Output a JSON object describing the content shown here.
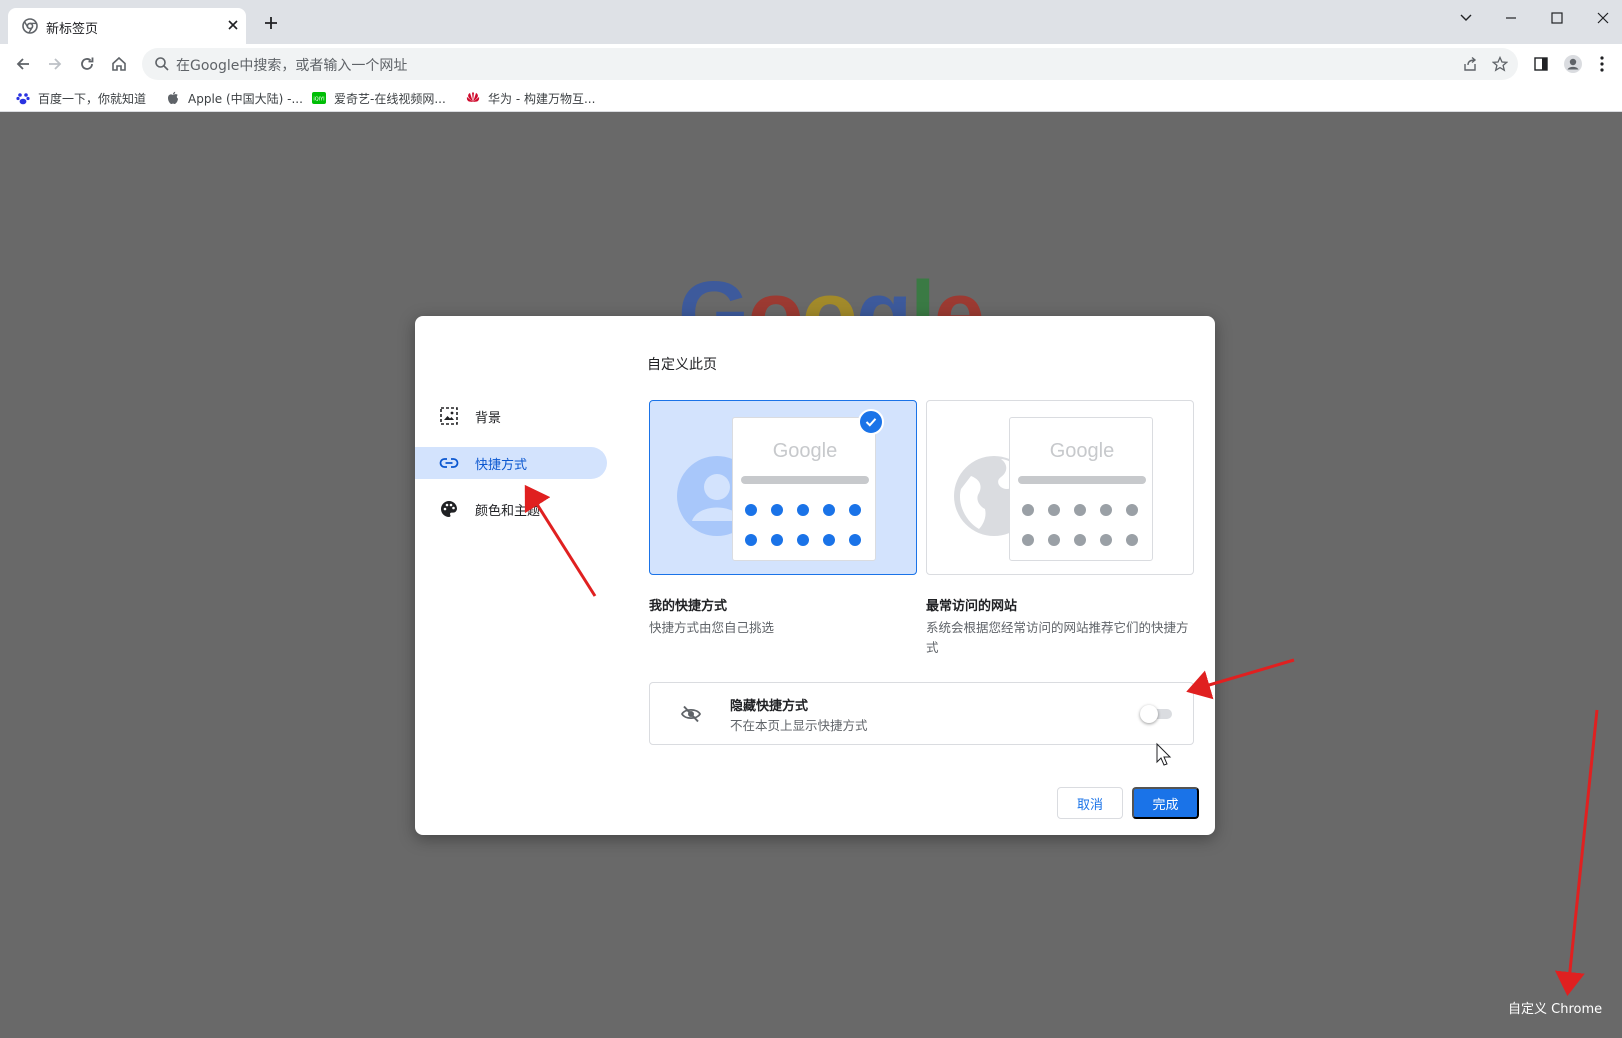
{
  "browser": {
    "tab_title": "新标签页",
    "omnibox_placeholder": "在Google中搜索，或者输入一个网址",
    "bookmarks": [
      {
        "label": "百度一下，你就知道",
        "icon": "baidu-icon"
      },
      {
        "label": "Apple (中国大陆) -...",
        "icon": "apple-icon"
      },
      {
        "label": "爱奇艺-在线视频网...",
        "icon": "iqiyi-icon"
      },
      {
        "label": "华为 - 构建万物互...",
        "icon": "huawei-icon"
      }
    ]
  },
  "page": {
    "logo_text": "Google",
    "customize_label": "自定义 Chrome"
  },
  "dialog": {
    "title": "自定义此页",
    "sidebar": [
      {
        "label": "背景",
        "icon": "background-image-icon",
        "active": false
      },
      {
        "label": "快捷方式",
        "icon": "link-icon",
        "active": true
      },
      {
        "label": "颜色和主题",
        "icon": "palette-icon",
        "active": false
      }
    ],
    "options": [
      {
        "title": "我的快捷方式",
        "desc": "快捷方式由您自己挑选",
        "mini_logo": "Google",
        "selected": true
      },
      {
        "title": "最常访问的网站",
        "desc": "系统会根据您经常访问的网站推荐它们的快捷方式",
        "mini_logo": "Google",
        "selected": false
      }
    ],
    "hide_shortcuts": {
      "title": "隐藏快捷方式",
      "desc": "不在本页上显示快捷方式",
      "enabled": false
    },
    "cancel_label": "取消",
    "done_label": "完成"
  },
  "colors": {
    "accent": "#1a73e8",
    "selected_card": "#d3e3fd",
    "page_overlay": "#696969",
    "annotation": "#e02020"
  }
}
